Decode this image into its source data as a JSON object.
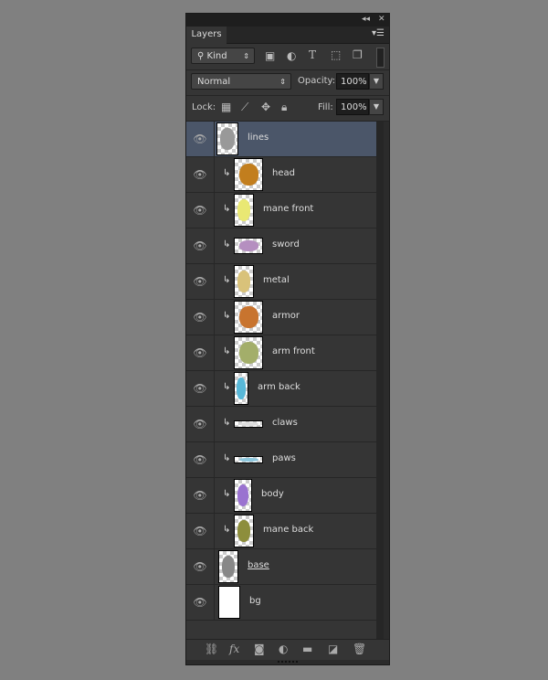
{
  "panel": {
    "tab": "Layers",
    "collapse_icon": "double-chevron-left-icon",
    "close_icon": "close-icon",
    "menu_icon": "panel-menu-icon"
  },
  "filter": {
    "kind_label": "Kind",
    "icons": [
      "image-filter-icon",
      "adjustment-filter-icon",
      "type-filter-icon",
      "shape-filter-icon",
      "smart-object-filter-icon"
    ]
  },
  "blend": {
    "mode": "Normal",
    "opacity_label": "Opacity:",
    "opacity": "100%"
  },
  "lock": {
    "label": "Lock:",
    "fill_label": "Fill:",
    "fill": "100%"
  },
  "layers": [
    {
      "name": "lines",
      "active": true,
      "clipped": false,
      "color": "#999999"
    },
    {
      "name": "head",
      "clipped": true,
      "color": "#c27e1e"
    },
    {
      "name": "mane front",
      "clipped": true,
      "color": "#e9e873"
    },
    {
      "name": "sword",
      "clipped": true,
      "color": "#b58fc0"
    },
    {
      "name": "metal",
      "clipped": true,
      "color": "#d9c27a"
    },
    {
      "name": "armor",
      "clipped": true,
      "color": "#c8742f"
    },
    {
      "name": "arm front",
      "clipped": true,
      "color": "#a3ae6a"
    },
    {
      "name": "arm back",
      "clipped": true,
      "color": "#58b8d8"
    },
    {
      "name": "claws",
      "clipped": true,
      "color": "#dddddd"
    },
    {
      "name": "paws",
      "clipped": true,
      "color": "#8cc7dd"
    },
    {
      "name": "body",
      "clipped": true,
      "color": "#9a72d0"
    },
    {
      "name": "mane back",
      "clipped": true,
      "color": "#8d8e3c"
    },
    {
      "name": "base",
      "clipped": false,
      "color": "#888888"
    },
    {
      "name": "bg",
      "clipped": false,
      "color": "#ffffff"
    }
  ],
  "footer": {
    "icons": [
      "link-layers-icon",
      "fx-icon",
      "add-mask-icon",
      "new-adjustment-icon",
      "new-group-icon",
      "new-layer-icon",
      "delete-icon"
    ],
    "fx": "fx"
  }
}
